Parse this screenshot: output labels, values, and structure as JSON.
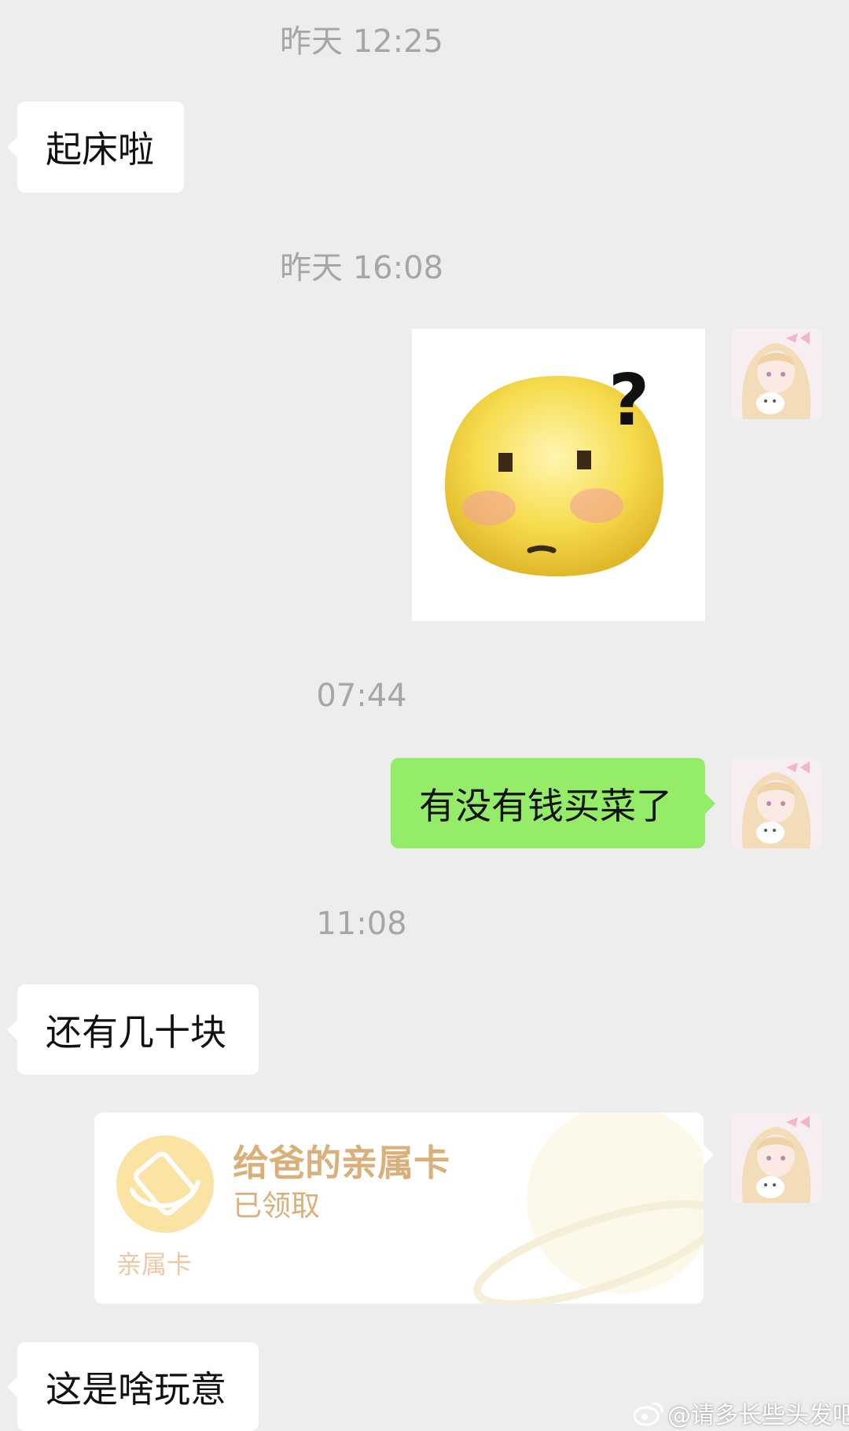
{
  "chat": {
    "messages": [
      {
        "timestamp": "昨天 12:25",
        "direction": "incoming",
        "type": "text",
        "text": "起床啦"
      },
      {
        "timestamp": "昨天 16:08",
        "direction": "outgoing",
        "type": "sticker",
        "sticker": "confused-blob-emoji-with-question-mark"
      },
      {
        "timestamp": "07:44",
        "direction": "outgoing",
        "type": "text",
        "text": "有没有钱买菜了"
      },
      {
        "timestamp": "11:08",
        "direction": "incoming",
        "type": "text",
        "text": "还有几十块"
      },
      {
        "direction": "outgoing",
        "type": "family-card",
        "card": {
          "title": "给爸的亲属卡",
          "status": "已领取",
          "footer": "亲属卡"
        }
      },
      {
        "direction": "incoming",
        "type": "text",
        "text": "这是啥玩意"
      }
    ]
  },
  "watermark": {
    "text": "@请多长些头发吧",
    "icon": "weibo-icon"
  },
  "colors": {
    "background": "#ededed",
    "incoming_bubble": "#ffffff",
    "outgoing_bubble": "#95ec69",
    "timestamp": "#a6a6a6",
    "card_accent": "#d9b07a"
  }
}
